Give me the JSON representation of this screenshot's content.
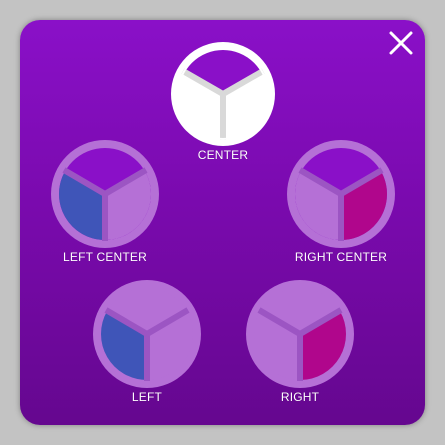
{
  "dialog": {
    "close_icon": "close-icon",
    "colors": {
      "panel_top": "#8a10c8",
      "panel_bottom": "#65078f",
      "ring_inactive": "#b570d6",
      "ring_active": "#ffffff",
      "segment_left_highlight": "#3f55b8",
      "segment_right_highlight": "#b0068c"
    }
  },
  "modes": [
    {
      "id": "center",
      "label": "CENTER",
      "icon": "speaker-center-icon",
      "selected": true
    },
    {
      "id": "left-center",
      "label": "LEFT CENTER",
      "icon": "speaker-left-center-icon",
      "selected": false
    },
    {
      "id": "right-center",
      "label": "RIGHT CENTER",
      "icon": "speaker-right-center-icon",
      "selected": false
    },
    {
      "id": "left",
      "label": "LEFT",
      "icon": "speaker-left-icon",
      "selected": false
    },
    {
      "id": "right",
      "label": "RIGHT",
      "icon": "speaker-right-icon",
      "selected": false
    }
  ]
}
